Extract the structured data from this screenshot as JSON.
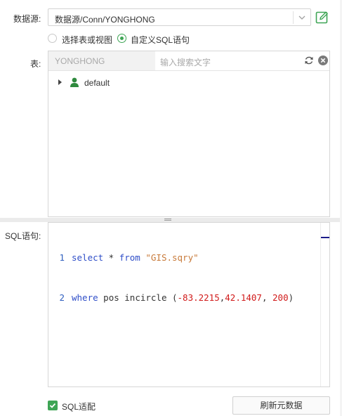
{
  "datasource": {
    "label": "数据源:",
    "value": "数据源/Conn/YONGHONG"
  },
  "mode": {
    "option_table": "选择表或视图",
    "option_sql": "自定义SQL语句",
    "selected": "sql"
  },
  "table": {
    "label": "表:",
    "name": "YONGHONG",
    "search_placeholder": "输入搜索文字",
    "tree": [
      {
        "label": "default",
        "icon": "user-icon"
      }
    ]
  },
  "sql": {
    "label": "SQL语句:",
    "line_numbers": [
      "1",
      "2"
    ],
    "line1": {
      "kw1": "select",
      "op": " * ",
      "kw2": "from",
      "str": "\"GIS.sqry\""
    },
    "line2": {
      "kw": "where",
      "txt": " pos incircle (",
      "n1": "-83.2215",
      "c1": ",",
      "n2": "42.1407",
      "c2": ", ",
      "n3": "200",
      "end": ")"
    }
  },
  "footer": {
    "checkbox_label": "SQL适配",
    "checkbox_checked": true,
    "refresh_button": "刷新元数据"
  },
  "colors": {
    "accent": "#3ea555",
    "keyword": "#2f4ec8",
    "string": "#c87a3a",
    "number": "#d11a1a"
  }
}
